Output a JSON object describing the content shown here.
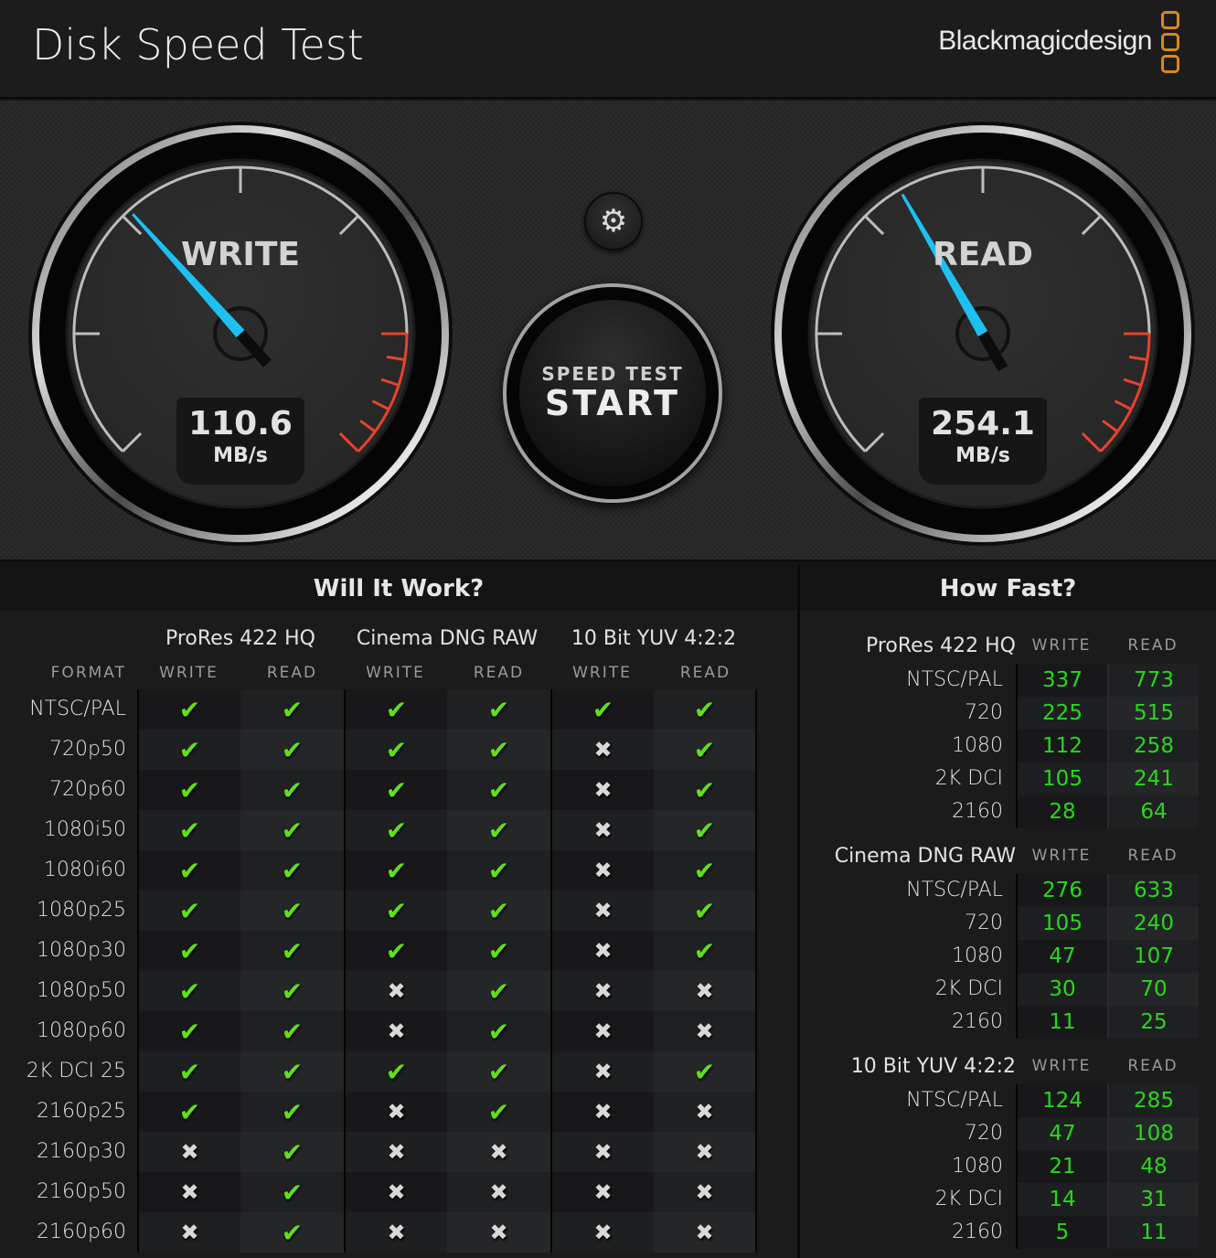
{
  "header": {
    "title": "Disk Speed Test",
    "brand": "Blackmagicdesign",
    "brand_color": "#d98a16"
  },
  "gauges": {
    "write": {
      "title": "WRITE",
      "value": "110.6",
      "unit": "MB/s",
      "needle_color": "#1ec0f2"
    },
    "read": {
      "title": "READ",
      "value": "254.1",
      "unit": "MB/s",
      "needle_color": "#1ec0f2"
    },
    "redline_color": "#e8422c"
  },
  "controls": {
    "settings_icon": "gear-icon",
    "start_sub": "SPEED TEST",
    "start_main": "START"
  },
  "will_it_work": {
    "title": "Will It Work?",
    "format_label": "FORMAT",
    "groups": [
      "ProRes 422 HQ",
      "Cinema DNG RAW",
      "10 Bit YUV 4:2:2"
    ],
    "subheaders": [
      "WRITE",
      "READ",
      "WRITE",
      "READ",
      "WRITE",
      "READ"
    ],
    "check_color": "#5fe01a",
    "rows": [
      {
        "format": "NTSC/PAL",
        "results": [
          true,
          true,
          true,
          true,
          true,
          true
        ]
      },
      {
        "format": "720p50",
        "results": [
          true,
          true,
          true,
          true,
          false,
          true
        ]
      },
      {
        "format": "720p60",
        "results": [
          true,
          true,
          true,
          true,
          false,
          true
        ]
      },
      {
        "format": "1080i50",
        "results": [
          true,
          true,
          true,
          true,
          false,
          true
        ]
      },
      {
        "format": "1080i60",
        "results": [
          true,
          true,
          true,
          true,
          false,
          true
        ]
      },
      {
        "format": "1080p25",
        "results": [
          true,
          true,
          true,
          true,
          false,
          true
        ]
      },
      {
        "format": "1080p30",
        "results": [
          true,
          true,
          true,
          true,
          false,
          true
        ]
      },
      {
        "format": "1080p50",
        "results": [
          true,
          true,
          false,
          true,
          false,
          false
        ]
      },
      {
        "format": "1080p60",
        "results": [
          true,
          true,
          false,
          true,
          false,
          false
        ]
      },
      {
        "format": "2K DCI 25",
        "results": [
          true,
          true,
          true,
          true,
          false,
          true
        ]
      },
      {
        "format": "2160p25",
        "results": [
          true,
          true,
          false,
          true,
          false,
          false
        ]
      },
      {
        "format": "2160p30",
        "results": [
          false,
          true,
          false,
          false,
          false,
          false
        ]
      },
      {
        "format": "2160p50",
        "results": [
          false,
          true,
          false,
          false,
          false,
          false
        ]
      },
      {
        "format": "2160p60",
        "results": [
          false,
          true,
          false,
          false,
          false,
          false
        ]
      }
    ]
  },
  "how_fast": {
    "title": "How Fast?",
    "value_color": "#27d81b",
    "sections": [
      {
        "group": "ProRes 422 HQ",
        "write_label": "WRITE",
        "read_label": "READ",
        "rows": [
          {
            "label": "NTSC/PAL",
            "write": "337",
            "read": "773"
          },
          {
            "label": "720",
            "write": "225",
            "read": "515"
          },
          {
            "label": "1080",
            "write": "112",
            "read": "258"
          },
          {
            "label": "2K DCI",
            "write": "105",
            "read": "241"
          },
          {
            "label": "2160",
            "write": "28",
            "read": "64"
          }
        ]
      },
      {
        "group": "Cinema DNG RAW",
        "write_label": "WRITE",
        "read_label": "READ",
        "rows": [
          {
            "label": "NTSC/PAL",
            "write": "276",
            "read": "633"
          },
          {
            "label": "720",
            "write": "105",
            "read": "240"
          },
          {
            "label": "1080",
            "write": "47",
            "read": "107"
          },
          {
            "label": "2K DCI",
            "write": "30",
            "read": "70"
          },
          {
            "label": "2160",
            "write": "11",
            "read": "25"
          }
        ]
      },
      {
        "group": "10 Bit YUV 4:2:2",
        "write_label": "WRITE",
        "read_label": "READ",
        "rows": [
          {
            "label": "NTSC/PAL",
            "write": "124",
            "read": "285"
          },
          {
            "label": "720",
            "write": "47",
            "read": "108"
          },
          {
            "label": "1080",
            "write": "21",
            "read": "48"
          },
          {
            "label": "2K DCI",
            "write": "14",
            "read": "31"
          },
          {
            "label": "2160",
            "write": "5",
            "read": "11"
          }
        ]
      }
    ]
  }
}
